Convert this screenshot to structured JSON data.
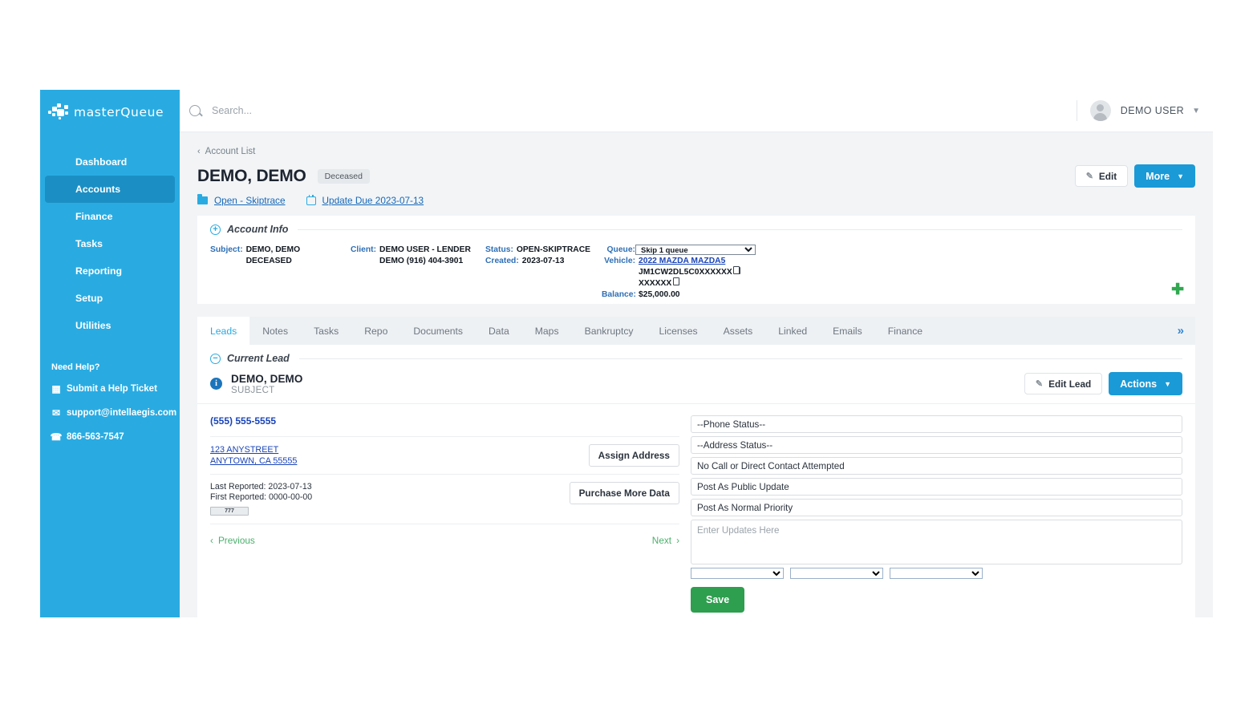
{
  "brand": {
    "name": "masterQueue",
    "sidebar_color": "#29abe2",
    "active_color": "#1b8fc4",
    "accent_blue": "#1a9ad7",
    "accent_green": "#2e9e4f"
  },
  "sidebar": {
    "items": [
      {
        "label": "Dashboard",
        "active": false
      },
      {
        "label": "Accounts",
        "active": true
      },
      {
        "label": "Finance",
        "active": false
      },
      {
        "label": "Tasks",
        "active": false
      },
      {
        "label": "Reporting",
        "active": false
      },
      {
        "label": "Setup",
        "active": false
      },
      {
        "label": "Utilities",
        "active": false
      }
    ],
    "help_title": "Need Help?",
    "help_items": [
      {
        "icon": "ticket-icon",
        "label": "Submit a Help Ticket"
      },
      {
        "icon": "envelope-icon",
        "label": "support@intellaegis.com"
      },
      {
        "icon": "phone-icon",
        "label": "866-563-7547"
      }
    ]
  },
  "topbar": {
    "search_placeholder": "Search...",
    "search_value": "",
    "user_name": "DEMO USER"
  },
  "account_header": {
    "breadcrumb": "Account List",
    "title": "DEMO, DEMO",
    "badge": "Deceased",
    "edit_label": "Edit",
    "more_label": "More",
    "status_link": "Open - Skiptrace",
    "due_link": "Update Due 2023-07-13"
  },
  "account_info": {
    "section_title": "Account Info",
    "subject_label": "Subject:",
    "subject_value": "DEMO, DEMO",
    "subject_value2": "DECEASED",
    "client_label": "Client:",
    "client_value": "DEMO USER - LENDER",
    "client_value2": "DEMO (916) 404-3901",
    "status_label": "Status:",
    "status_value": "OPEN-SKIPTRACE",
    "created_label": "Created:",
    "created_value": "2023-07-13",
    "queue_label": "Queue:",
    "queue_value": "Skip 1 queue",
    "vehicle_label": "Vehicle:",
    "vehicle_value": "2022 MAZDA MAZDA5",
    "vin_value": "JM1CW2DL5C0XXXXXX",
    "vin2_value": "XXXXXX",
    "balance_label": "Balance:",
    "balance_value": "$25,000.00",
    "add_icon": "plus-icon"
  },
  "tabs": {
    "items": [
      {
        "label": "Leads",
        "active": true
      },
      {
        "label": "Notes",
        "active": false
      },
      {
        "label": "Tasks",
        "active": false
      },
      {
        "label": "Repo",
        "active": false
      },
      {
        "label": "Documents",
        "active": false
      },
      {
        "label": "Data",
        "active": false
      },
      {
        "label": "Maps",
        "active": false
      },
      {
        "label": "Bankruptcy",
        "active": false
      },
      {
        "label": "Licenses",
        "active": false
      },
      {
        "label": "Assets",
        "active": false
      },
      {
        "label": "Linked",
        "active": false
      },
      {
        "label": "Emails",
        "active": false
      },
      {
        "label": "Finance",
        "active": false
      }
    ],
    "overflow_icon": "double-chevron-right-icon"
  },
  "current_lead": {
    "section_title": "Current Lead",
    "person_name": "DEMO, DEMO",
    "person_role": "SUBJECT",
    "edit_lead_label": "Edit Lead",
    "actions_label": "Actions",
    "phone": "(555) 555-5555",
    "address_line1": "123 ANYSTREET",
    "address_line2": "ANYTOWN, CA 55555",
    "assign_address_label": "Assign Address",
    "last_reported": "Last Reported: 2023-07-13",
    "first_reported": "First Reported: 0000-00-00",
    "score_badge": "777",
    "purchase_label": "Purchase More Data",
    "previous_label": "Previous",
    "next_label": "Next"
  },
  "update_form": {
    "phone_status": "--Phone Status--",
    "address_status": "--Address Status--",
    "contact_status": "No Call or Direct Contact Attempted",
    "visibility": "Post As Public Update",
    "priority": "Post As Normal Priority",
    "notes_placeholder": "Enter Updates Here",
    "notes_value": "",
    "select1": "",
    "select2": "",
    "select3": "",
    "save_label": "Save"
  }
}
